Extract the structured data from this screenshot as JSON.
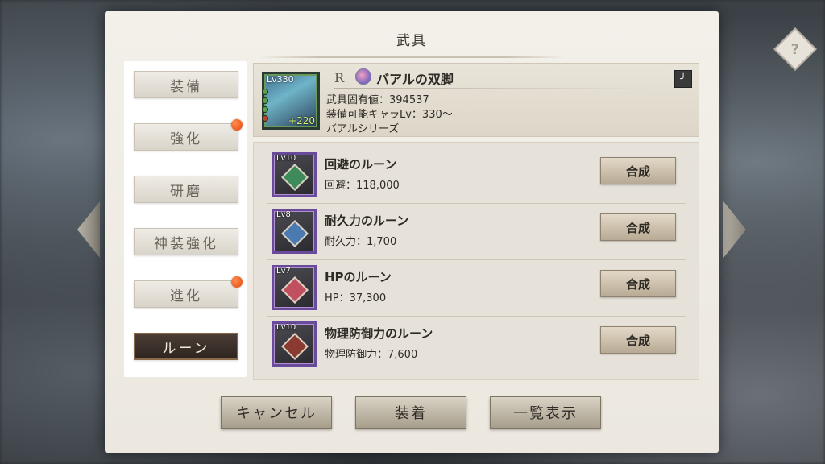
{
  "dialog": {
    "title": "武具",
    "help_label": "?"
  },
  "tabs": [
    {
      "label": "装備",
      "badge": false,
      "active": false
    },
    {
      "label": "強化",
      "badge": true,
      "active": false
    },
    {
      "label": "研磨",
      "badge": false,
      "active": false
    },
    {
      "label": "神装強化",
      "badge": false,
      "active": false
    },
    {
      "label": "進化",
      "badge": true,
      "active": false
    },
    {
      "label": "ルーン",
      "badge": false,
      "active": true
    }
  ],
  "weapon": {
    "level": "Lv330",
    "plus": "+220",
    "rarity": "R",
    "name": "バアルの双脚",
    "value_line": "武具固有値：394537",
    "equip_line": "装備可能キャラLv：330～",
    "series_line": "バアルシリーズ"
  },
  "runes": [
    {
      "level": "Lv10",
      "name": "回避のルーン",
      "stat": "回避：118,000",
      "button": "合成",
      "color": "#3f8a5a"
    },
    {
      "level": "Lv8",
      "name": "耐久力のルーン",
      "stat": "耐久力：1,700",
      "button": "合成",
      "color": "#4a7ab0"
    },
    {
      "level": "Lv7",
      "name": "HPのルーン",
      "stat": "HP：37,300",
      "button": "合成",
      "color": "#c05060"
    },
    {
      "level": "Lv10",
      "name": "物理防御力のルーン",
      "stat": "物理防御力：7,600",
      "button": "合成",
      "color": "#8a3a30"
    }
  ],
  "buttons": {
    "cancel": "キャンセル",
    "equip": "装着",
    "list": "一覧表示"
  }
}
